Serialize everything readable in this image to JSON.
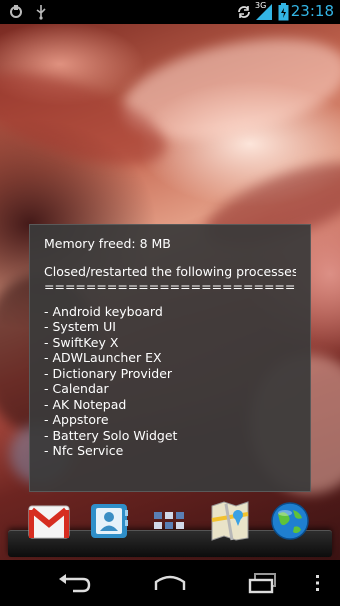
{
  "status_bar": {
    "time": "23:18",
    "network_label": "3G",
    "accent_color": "#33b5e5",
    "icons": [
      "notification-icon",
      "usb-icon",
      "sync-icon",
      "signal-icon",
      "battery-icon"
    ]
  },
  "dialog": {
    "memory_line": "Memory freed: 8 MB",
    "heading": "Closed/restarted the following processes:",
    "separator": "===============================",
    "processes": [
      "- Android keyboard",
      "- System UI",
      "- SwiftKey X",
      "- ADWLauncher EX",
      "- Dictionary Provider",
      "- Calendar",
      "- AK Notepad",
      "- Appstore",
      "- Battery Solo Widget",
      "- Nfc Service"
    ]
  },
  "dock": {
    "apps": [
      "gmail-icon",
      "contacts-icon",
      "app-drawer-icon",
      "maps-icon",
      "browser-icon"
    ]
  },
  "nav_bar": {
    "buttons": [
      "back-icon",
      "home-icon",
      "recent-apps-icon",
      "menu-icon"
    ]
  }
}
